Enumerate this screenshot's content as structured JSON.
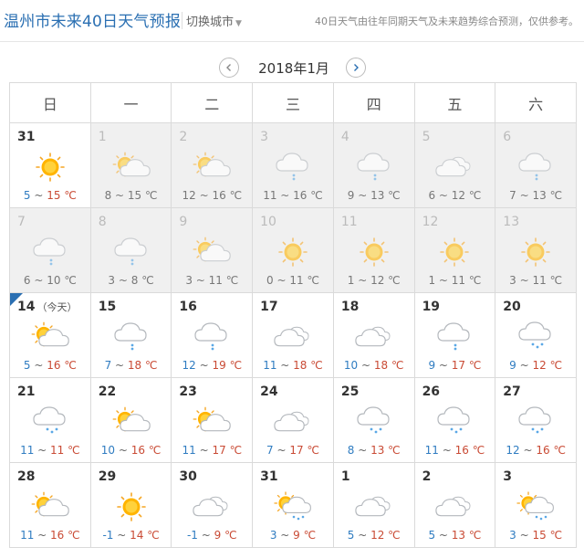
{
  "header": {
    "title": "温州市未来40日天气预报",
    "switch_label": "切换城市",
    "note": "40日天气由往年同期天气及未来趋势综合预测，仅供参考。"
  },
  "nav": {
    "month": "2018年1月"
  },
  "weekdays": [
    "日",
    "一",
    "二",
    "三",
    "四",
    "五",
    "六"
  ],
  "today_label": "（今天）",
  "days": [
    {
      "date": "31",
      "icon": "sunny",
      "low": "5",
      "high": "15",
      "unit": "℃",
      "muted": false
    },
    {
      "date": "1",
      "icon": "partly-cloudy",
      "low": "8",
      "high": "15",
      "unit": "℃",
      "muted": true
    },
    {
      "date": "2",
      "icon": "partly-cloudy",
      "low": "12",
      "high": "16",
      "unit": "℃",
      "muted": true
    },
    {
      "date": "3",
      "icon": "light-rain",
      "low": "11",
      "high": "16",
      "unit": "℃",
      "muted": true
    },
    {
      "date": "4",
      "icon": "light-rain",
      "low": "9",
      "high": "13",
      "unit": "℃",
      "muted": true
    },
    {
      "date": "5",
      "icon": "cloudy",
      "low": "6",
      "high": "12",
      "unit": "℃",
      "muted": true
    },
    {
      "date": "6",
      "icon": "light-rain",
      "low": "7",
      "high": "13",
      "unit": "℃",
      "muted": true
    },
    {
      "date": "7",
      "icon": "light-rain",
      "low": "6",
      "high": "10",
      "unit": "℃",
      "muted": true
    },
    {
      "date": "8",
      "icon": "light-rain",
      "low": "3",
      "high": "8",
      "unit": "℃",
      "muted": true
    },
    {
      "date": "9",
      "icon": "partly-cloudy",
      "low": "3",
      "high": "11",
      "unit": "℃",
      "muted": true
    },
    {
      "date": "10",
      "icon": "sunny",
      "low": "0",
      "high": "11",
      "unit": "℃",
      "muted": true
    },
    {
      "date": "11",
      "icon": "sunny",
      "low": "1",
      "high": "12",
      "unit": "℃",
      "muted": true
    },
    {
      "date": "12",
      "icon": "sunny",
      "low": "1",
      "high": "11",
      "unit": "℃",
      "muted": true
    },
    {
      "date": "13",
      "icon": "sunny",
      "low": "3",
      "high": "11",
      "unit": "℃",
      "muted": true
    },
    {
      "date": "14",
      "icon": "partly-cloudy",
      "low": "5",
      "high": "16",
      "unit": "℃",
      "muted": false,
      "today": true
    },
    {
      "date": "15",
      "icon": "light-rain",
      "low": "7",
      "high": "18",
      "unit": "℃",
      "muted": false
    },
    {
      "date": "16",
      "icon": "light-rain",
      "low": "12",
      "high": "19",
      "unit": "℃",
      "muted": false
    },
    {
      "date": "17",
      "icon": "cloudy",
      "low": "11",
      "high": "18",
      "unit": "℃",
      "muted": false
    },
    {
      "date": "18",
      "icon": "cloudy",
      "low": "10",
      "high": "18",
      "unit": "℃",
      "muted": false
    },
    {
      "date": "19",
      "icon": "light-rain",
      "low": "9",
      "high": "17",
      "unit": "℃",
      "muted": false
    },
    {
      "date": "20",
      "icon": "rain",
      "low": "9",
      "high": "12",
      "unit": "℃",
      "muted": false
    },
    {
      "date": "21",
      "icon": "rain",
      "low": "11",
      "high": "11",
      "unit": "℃",
      "muted": false
    },
    {
      "date": "22",
      "icon": "partly-cloudy",
      "low": "10",
      "high": "16",
      "unit": "℃",
      "muted": false
    },
    {
      "date": "23",
      "icon": "partly-cloudy",
      "low": "11",
      "high": "17",
      "unit": "℃",
      "muted": false
    },
    {
      "date": "24",
      "icon": "cloudy",
      "low": "7",
      "high": "17",
      "unit": "℃",
      "muted": false
    },
    {
      "date": "25",
      "icon": "rain",
      "low": "8",
      "high": "13",
      "unit": "℃",
      "muted": false
    },
    {
      "date": "26",
      "icon": "rain",
      "low": "11",
      "high": "16",
      "unit": "℃",
      "muted": false
    },
    {
      "date": "27",
      "icon": "rain",
      "low": "12",
      "high": "16",
      "unit": "℃",
      "muted": false
    },
    {
      "date": "28",
      "icon": "partly-cloudy",
      "low": "11",
      "high": "16",
      "unit": "℃",
      "muted": false
    },
    {
      "date": "29",
      "icon": "sunny",
      "low": "-1",
      "high": "14",
      "unit": "℃",
      "muted": false
    },
    {
      "date": "30",
      "icon": "cloudy",
      "low": "-1",
      "high": "9",
      "unit": "℃",
      "muted": false
    },
    {
      "date": "31",
      "icon": "sun-shower",
      "low": "3",
      "high": "9",
      "unit": "℃",
      "muted": false
    },
    {
      "date": "1",
      "icon": "cloudy",
      "low": "5",
      "high": "12",
      "unit": "℃",
      "muted": false
    },
    {
      "date": "2",
      "icon": "cloudy",
      "low": "5",
      "high": "13",
      "unit": "℃",
      "muted": false
    },
    {
      "date": "3",
      "icon": "sun-shower",
      "low": "3",
      "high": "15",
      "unit": "℃",
      "muted": false
    }
  ]
}
